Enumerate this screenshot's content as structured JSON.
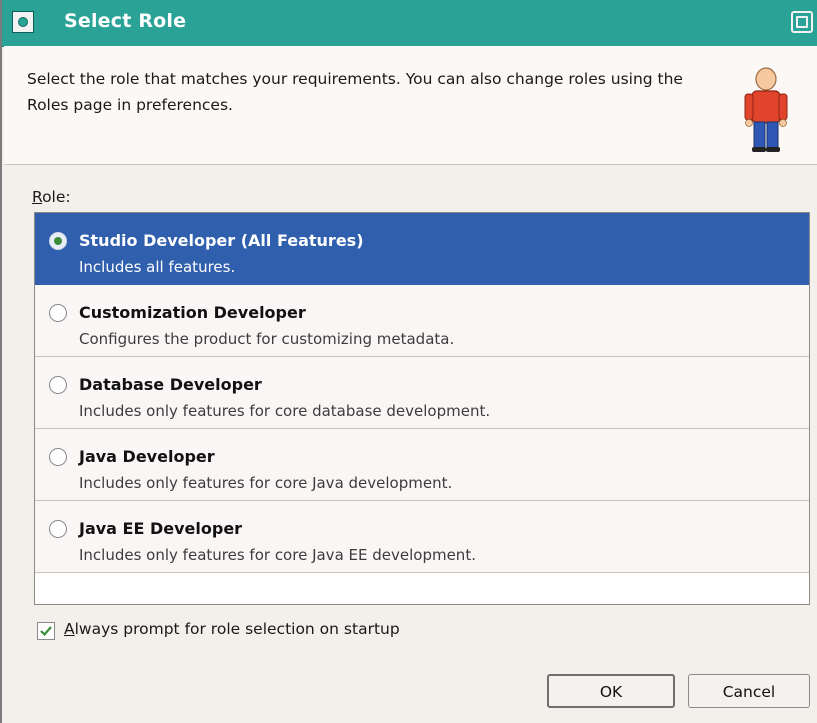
{
  "window": {
    "title": "Select Role"
  },
  "header": {
    "description": "Select the role that matches your requirements. You can also change roles using the Roles page in preferences.",
    "icon": "person-icon"
  },
  "role_label": {
    "mnemonic": "R",
    "rest": "ole:"
  },
  "roles": [
    {
      "name": "Studio Developer (All Features)",
      "description": "Includes all features.",
      "selected": true
    },
    {
      "name": "Customization Developer",
      "description": "Configures the product for customizing metadata.",
      "selected": false
    },
    {
      "name": "Database Developer",
      "description": "Includes only features for core database development.",
      "selected": false
    },
    {
      "name": "Java Developer",
      "description": "Includes only features for core Java development.",
      "selected": false
    },
    {
      "name": "Java EE Developer",
      "description": "Includes only features for core Java EE development.",
      "selected": false
    }
  ],
  "startup_prompt": {
    "mnemonic": "A",
    "rest": "lways prompt for role selection on startup",
    "checked": true
  },
  "buttons": {
    "ok": "OK",
    "cancel": "Cancel"
  },
  "colors": {
    "titlebar": "#2aa396",
    "selection": "#2f5fad",
    "radio_selected": "#3a8d3a"
  }
}
